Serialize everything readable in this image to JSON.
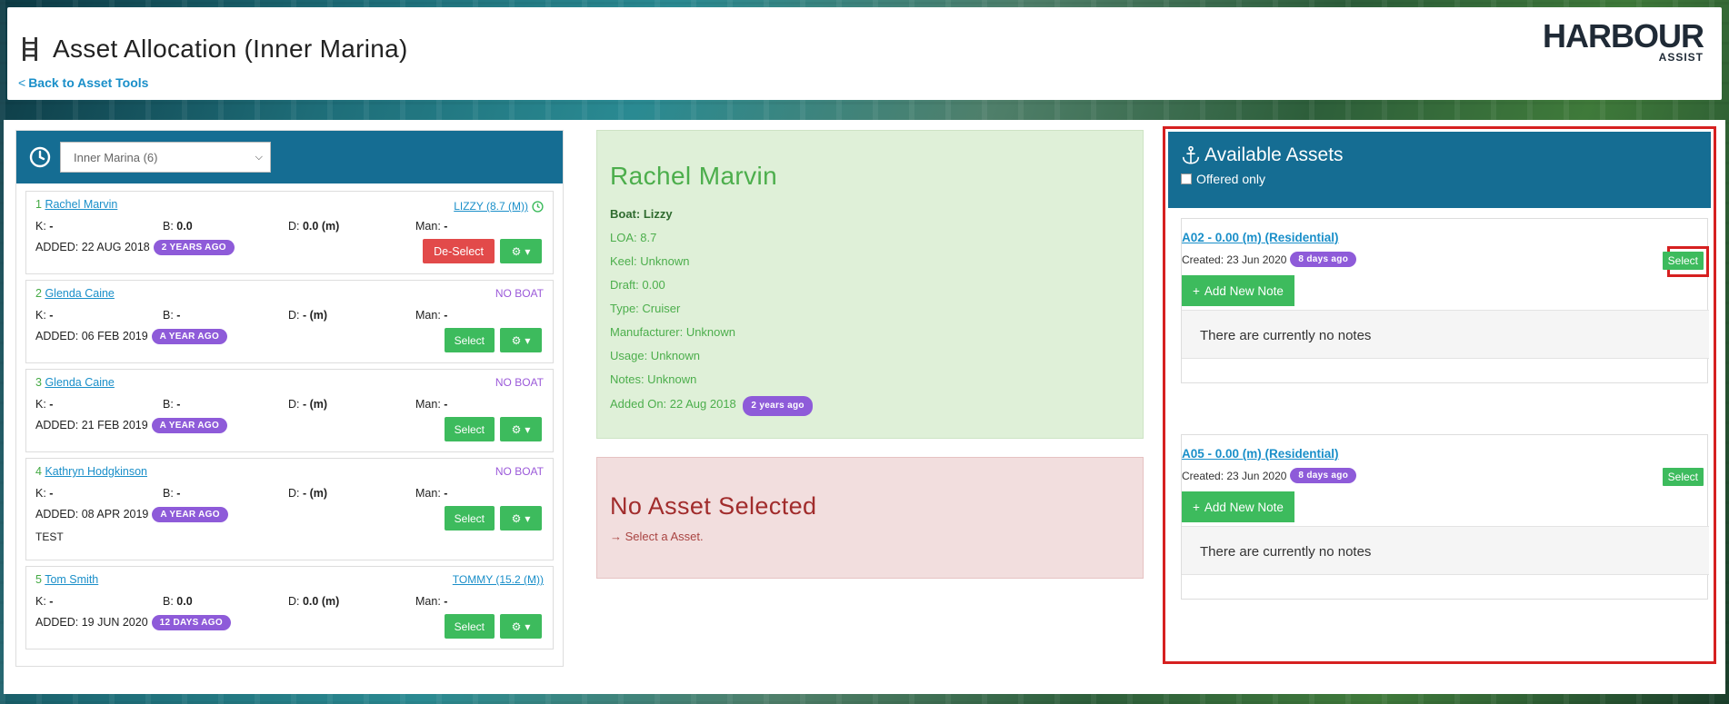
{
  "header": {
    "title": "Asset Allocation (Inner Marina)",
    "back_label": "Back to Asset Tools",
    "logo_main": "HARBOUR",
    "logo_sub": "ASSIST"
  },
  "left": {
    "marina_select": "Inner Marina (6)",
    "members": [
      {
        "num": "1",
        "name": "Rachel Marvin",
        "boat": "LIZZY (8.7 (M))",
        "boat_type": "link",
        "k": "-",
        "b": "0.0",
        "d": "0.0 (m)",
        "man": "-",
        "added": "ADDED: 22 AUG 2018",
        "badge": "2 YEARS AGO",
        "primary": "De-Select",
        "extra": ""
      },
      {
        "num": "2",
        "name": "Glenda Caine",
        "boat": "NO BOAT",
        "boat_type": "none",
        "k": "-",
        "b": "-",
        "d": "- (m)",
        "man": "-",
        "added": "ADDED: 06 FEB 2019",
        "badge": "A YEAR AGO",
        "primary": "Select",
        "extra": ""
      },
      {
        "num": "3",
        "name": "Glenda Caine",
        "boat": "NO BOAT",
        "boat_type": "none",
        "k": "-",
        "b": "-",
        "d": "- (m)",
        "man": "-",
        "added": "ADDED: 21 FEB 2019",
        "badge": "A YEAR AGO",
        "primary": "Select",
        "extra": ""
      },
      {
        "num": "4",
        "name": "Kathryn Hodgkinson",
        "boat": "NO BOAT",
        "boat_type": "none",
        "k": "-",
        "b": "-",
        "d": "- (m)",
        "man": "-",
        "added": "ADDED: 08 APR 2019",
        "badge": "A YEAR AGO",
        "primary": "Select",
        "extra": "TEST"
      },
      {
        "num": "5",
        "name": "Tom Smith",
        "boat": "TOMMY (15.2 (M))",
        "boat_type": "link",
        "k": "-",
        "b": "0.0",
        "d": "0.0 (m)",
        "man": "-",
        "added": "ADDED: 19 JUN 2020",
        "badge": "12 DAYS AGO",
        "primary": "Select",
        "extra": ""
      }
    ],
    "labels": {
      "k": "K:",
      "b": "B:",
      "d": "D:",
      "man": "Man:"
    }
  },
  "member_detail": {
    "name": "Rachel Marvin",
    "boat_label": "Boat:",
    "boat": "Lizzy",
    "loa": "LOA: 8.7",
    "keel": "Keel: Unknown",
    "draft": "Draft: 0.00",
    "type": "Type: Cruiser",
    "manufacturer": "Manufacturer: Unknown",
    "usage": "Usage: Unknown",
    "notes": "Notes: Unknown",
    "added_on": "Added On: 22 Aug 2018",
    "added_badge": "2 years ago"
  },
  "asset_status": {
    "title": "No Asset Selected",
    "hint": "Select a Asset."
  },
  "available": {
    "title": "Available Assets",
    "offered_only": "Offered only",
    "assets": [
      {
        "name": "A02 - 0.00 (m) (Residential)",
        "created": "Created: 23 Jun 2020",
        "badge": "8 days ago",
        "select": "Select",
        "add_note": "Add New Note",
        "notes_empty": "There are currently no notes"
      },
      {
        "name": "A05 - 0.00 (m) (Residential)",
        "created": "Created: 23 Jun 2020",
        "badge": "8 days ago",
        "select": "Select",
        "add_note": "Add New Note",
        "notes_empty": "There are currently no notes"
      }
    ]
  },
  "colors": {
    "header_blue": "#156d93",
    "green": "#3dbb5d",
    "red": "#e24a4a",
    "purple": "#8e5bd9",
    "link": "#1a8fc9",
    "highlight": "#d62020"
  }
}
